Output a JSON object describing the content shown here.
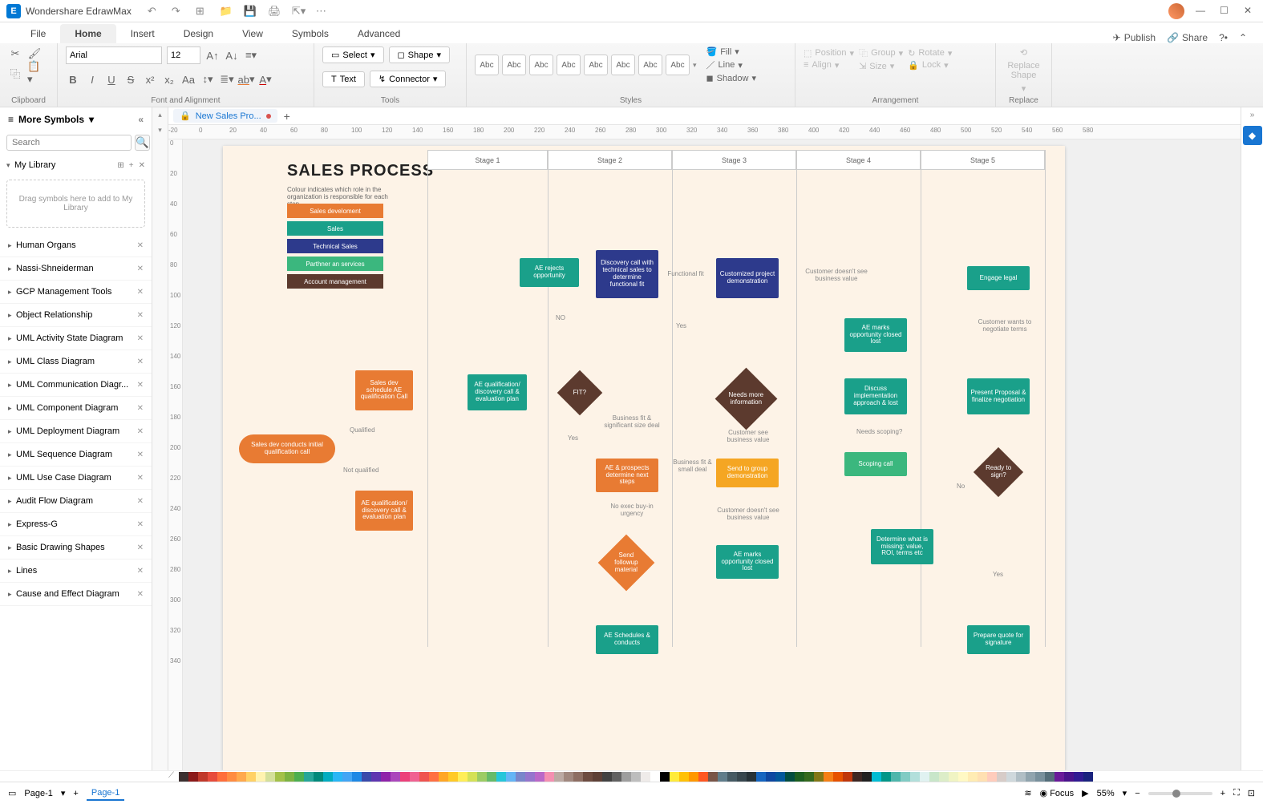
{
  "app": {
    "title": "Wondershare EdrawMax"
  },
  "menu": {
    "tabs": [
      "File",
      "Home",
      "Insert",
      "Design",
      "View",
      "Symbols",
      "Advanced"
    ],
    "publish": "Publish",
    "share": "Share"
  },
  "ribbon": {
    "clipboard": "Clipboard",
    "font_alignment": "Font and Alignment",
    "tools": "Tools",
    "styles": "Styles",
    "arrangement": "Arrangement",
    "replace": "Replace",
    "font": "Arial",
    "size": "12",
    "select": "Select",
    "shape": "Shape",
    "text": "Text",
    "connector": "Connector",
    "style_label": "Abc",
    "fill": "Fill",
    "line": "Line",
    "shadow": "Shadow",
    "position": "Position",
    "align": "Align",
    "group": "Group",
    "size_lbl": "Size",
    "rotate": "Rotate",
    "lock": "Lock",
    "replace_shape": "Replace\nShape"
  },
  "sidebar": {
    "title": "More Symbols",
    "search_placeholder": "Search",
    "mylib": "My Library",
    "drop_hint": "Drag symbols here to add to My Library",
    "items": [
      "Human Organs",
      "Nassi-Shneiderman",
      "GCP Management Tools",
      "Object Relationship",
      "UML Activity State Diagram",
      "UML Class Diagram",
      "UML Communication Diagr...",
      "UML Component Diagram",
      "UML Deployment Diagram",
      "UML Sequence Diagram",
      "UML Use Case Diagram",
      "Audit Flow Diagram",
      "Express-G",
      "Basic Drawing Shapes",
      "Lines",
      "Cause and Effect Diagram"
    ]
  },
  "doc": {
    "tab": "New Sales Pro..."
  },
  "status": {
    "page": "Page-1",
    "focus": "Focus",
    "zoom": "55%"
  },
  "ruler": {
    "h": [
      "-20",
      "0",
      "20",
      "40",
      "60",
      "80",
      "100",
      "120",
      "140",
      "160",
      "180",
      "200",
      "220",
      "240",
      "260",
      "280",
      "300",
      "320",
      "340",
      "360",
      "380",
      "400",
      "420",
      "440",
      "460",
      "480",
      "500",
      "520",
      "540",
      "560",
      "580"
    ],
    "v": [
      "0",
      "20",
      "40",
      "60",
      "80",
      "100",
      "120",
      "140",
      "160",
      "180",
      "200",
      "220",
      "240",
      "260",
      "280",
      "300",
      "320",
      "340"
    ]
  },
  "chart_data": {
    "title": "SALES PROCESS",
    "subtitle": "Colour indicates which role in the organization is responsible for each step",
    "legend": [
      {
        "label": "Sales develoment",
        "color": "#e87b33"
      },
      {
        "label": "Sales",
        "color": "#1aa08a"
      },
      {
        "label": "Technical Sales",
        "color": "#2d3a8c"
      },
      {
        "label": "Parthner an services",
        "color": "#3bb77e"
      },
      {
        "label": "Account management",
        "color": "#5c3a2e"
      }
    ],
    "stages": [
      "Stage 1",
      "Stage 2",
      "Stage 3",
      "Stage 4",
      "Stage 5"
    ],
    "nodes": {
      "n_init": "Sales dev conducts initial qualification call",
      "n_sched": "Sales dev schedule AE qualification Call",
      "n_aequal": "AE qualification/ discovery call & evaluation plan",
      "n_aequal2": "AE qualification/ discovery call & evaluation plan",
      "n_reject": "AE rejects opportunity",
      "n_fit": "FIT?",
      "n_disc": "Discovery call with technical sales to determine functional fit",
      "n_prospects": "AE & prospects determine next steps",
      "n_followup": "Send followup material",
      "n_sched2": "AE Schedules & conducts",
      "n_demo": "Customized project demonstration",
      "n_needinfo": "Needs more information",
      "n_sendgroup": "Send to group demonstration",
      "n_closed1": "AE marks opportunity closed lost",
      "n_closed2": "AE marks opportunity closed lost",
      "n_discuss": "Discuss implementation approach & lost",
      "n_scoping": "Scoping call",
      "n_missing": "Determine what is missing: value, ROI, terms etc",
      "n_engage": "Engage legal",
      "n_custneg": "Customer wants to negotiate terms",
      "n_present": "Present Proposal & finalize negotiation",
      "n_ready": "Ready to sign?",
      "n_quote": "Prepare quote for signature"
    },
    "annotations": {
      "qualified": "Qualified",
      "notqual": "Not qualified",
      "no": "NO",
      "yes": "Yes",
      "yes2": "Yes",
      "no2": "No",
      "funcfit": "Functional fit",
      "bizfit": "Business fit & significant size deal",
      "bizsmall": "Business fit & small deal",
      "noexec": "No exec buy-in urgency",
      "custsee": "Customer see business value",
      "custnosee": "Customer doesn't see business value",
      "custnosee2": "Customer doesn't see business value",
      "needscope": "Needs scoping?"
    }
  },
  "colors": [
    "#3b2f2f",
    "#8b1a1a",
    "#c0392b",
    "#e74c3c",
    "#ff6f3c",
    "#ff8c42",
    "#ffa94d",
    "#ffd166",
    "#fff3b0",
    "#d4e09b",
    "#a3c14a",
    "#7cb342",
    "#4caf50",
    "#26a69a",
    "#00897b",
    "#00acc1",
    "#29b6f6",
    "#42a5f5",
    "#1e88e5",
    "#3949ab",
    "#5e35b1",
    "#8e24aa",
    "#ab47bc",
    "#ec407a",
    "#f06292",
    "#ef5350",
    "#ff7043",
    "#ffa726",
    "#ffca28",
    "#ffee58",
    "#d4e157",
    "#9ccc65",
    "#66bb6a",
    "#26c6da",
    "#64b5f6",
    "#7986cb",
    "#9575cd",
    "#ba68c8",
    "#f48fb1",
    "#bcaaa4",
    "#a1887f",
    "#8d6e63",
    "#6d4c41",
    "#5d4037",
    "#424242",
    "#616161",
    "#9e9e9e",
    "#bdbdbd",
    "#efebe9",
    "#ffffff",
    "#000000",
    "#ffeb3b",
    "#ffc107",
    "#ff9800",
    "#ff5722",
    "#795548",
    "#607d8b",
    "#455a64",
    "#37474f",
    "#263238",
    "#1565c0",
    "#0d47a1",
    "#01579b",
    "#004d40",
    "#1b5e20",
    "#33691e",
    "#827717",
    "#f57f17",
    "#e65100",
    "#bf360c",
    "#3e2723",
    "#212121",
    "#00bcd4",
    "#009688",
    "#4db6ac",
    "#80cbc4",
    "#b2dfdb",
    "#e0f2f1",
    "#c8e6c9",
    "#dcedc8",
    "#f0f4c3",
    "#fff9c4",
    "#ffecb3",
    "#ffe0b2",
    "#ffccbc",
    "#d7ccc8",
    "#cfd8dc",
    "#b0bec5",
    "#90a4ae",
    "#78909c",
    "#546e7a",
    "#6a1b9a",
    "#4a148c",
    "#311b92",
    "#1a237e"
  ]
}
